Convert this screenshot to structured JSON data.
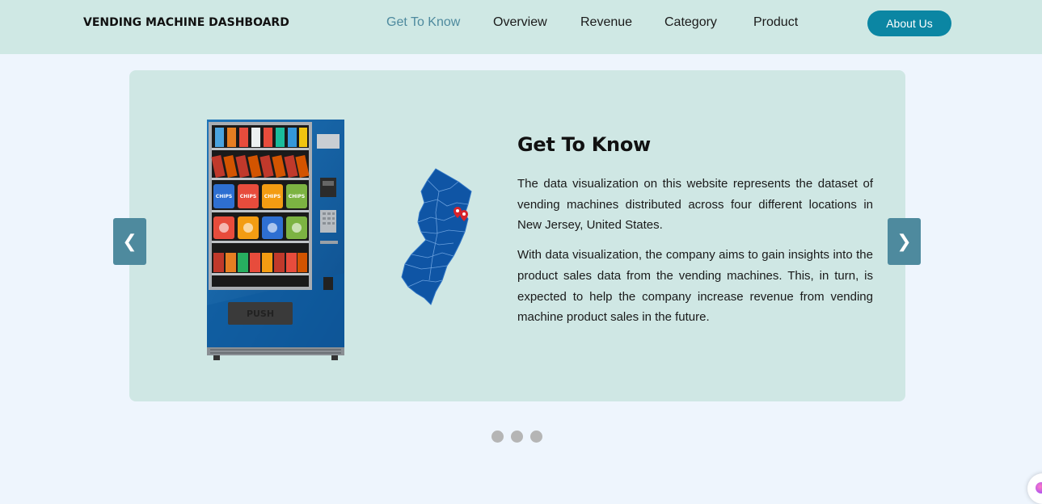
{
  "header": {
    "brand": "VENDING MACHINE DASHBOARD",
    "nav": [
      {
        "label": "Get To Know",
        "active": true
      },
      {
        "label": "Overview",
        "active": false
      },
      {
        "label": "Revenue",
        "active": false
      },
      {
        "label": "Category",
        "active": false
      },
      {
        "label": "Product",
        "active": false
      }
    ],
    "about_label": "About Us"
  },
  "slide": {
    "heading": "Get To Know",
    "paragraphs": [
      "The data visualization on this website represents the dataset of vending machines distributed across four different locations in New Jersey, United States.",
      "With data visualization, the company aims to gain insights into the product sales data from the vending machines. This, in turn, is expected to help the company increase revenue from vending machine product sales in the future."
    ],
    "vending_push_label": "PUSH",
    "chips_label": "CHIPS"
  },
  "carousel": {
    "prev_icon": "chevron-left-icon",
    "next_icon": "chevron-right-icon",
    "prev_glyph": "❮",
    "next_glyph": "❯",
    "dot_count": 3
  },
  "colors": {
    "nav_bg": "#cfe8e4",
    "card_bg": "#cfe7e4",
    "accent": "#0b86a3",
    "arrow_bg": "#4e8a9e",
    "active_link": "#4e8a9e",
    "map_blue": "#0f55a5",
    "pin_red": "#d8232a"
  }
}
